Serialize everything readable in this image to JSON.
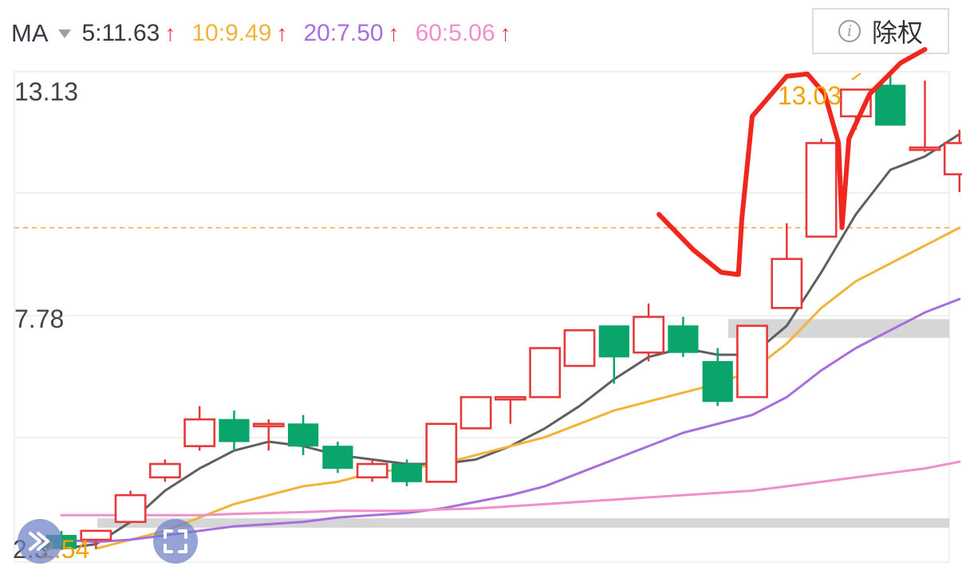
{
  "header": {
    "indicator_label": "MA",
    "ma_items": [
      {
        "text": "5:11.63",
        "color": "#333a44",
        "arrow": "↑"
      },
      {
        "text": "10:9.49",
        "color": "#f2b339",
        "arrow": "↑"
      },
      {
        "text": "20:7.50",
        "color": "#a86ee0",
        "arrow": "↑"
      },
      {
        "text": "60:5.06",
        "color": "#ef8fcb",
        "arrow": "↑"
      }
    ],
    "exright_icon": "i",
    "exright_label": "除权"
  },
  "chart_data": {
    "type": "candlestick",
    "price_high_label": "13.13",
    "price_mid_label": "7.78",
    "price_low_label": "2.54",
    "price_low_label_partial": "2.3",
    "max_marker_label": "13.03",
    "ylim": [
      2.3,
      13.3
    ],
    "reference_price": 9.8,
    "up_color": "#e63a3a",
    "down_color": "#0aa56b",
    "candles": [
      {
        "o": 2.9,
        "h": 3.0,
        "l": 2.6,
        "c": 2.6
      },
      {
        "o": 2.8,
        "h": 3.0,
        "l": 2.6,
        "c": 3.0
      },
      {
        "o": 3.2,
        "h": 3.9,
        "l": 3.2,
        "c": 3.8
      },
      {
        "o": 4.2,
        "h": 4.6,
        "l": 4.1,
        "c": 4.5
      },
      {
        "o": 4.9,
        "h": 5.8,
        "l": 4.8,
        "c": 5.5
      },
      {
        "o": 5.5,
        "h": 5.7,
        "l": 4.8,
        "c": 5.0
      },
      {
        "o": 5.4,
        "h": 5.5,
        "l": 4.8,
        "c": 5.4
      },
      {
        "o": 5.4,
        "h": 5.6,
        "l": 4.7,
        "c": 4.9
      },
      {
        "o": 4.9,
        "h": 5.0,
        "l": 4.3,
        "c": 4.4
      },
      {
        "o": 4.2,
        "h": 4.6,
        "l": 4.1,
        "c": 4.5
      },
      {
        "o": 4.5,
        "h": 4.6,
        "l": 4.0,
        "c": 4.1
      },
      {
        "o": 4.1,
        "h": 5.4,
        "l": 4.1,
        "c": 5.4
      },
      {
        "o": 5.3,
        "h": 6.0,
        "l": 5.3,
        "c": 6.0
      },
      {
        "o": 6.0,
        "h": 6.0,
        "l": 5.4,
        "c": 6.0
      },
      {
        "o": 6.0,
        "h": 7.1,
        "l": 6.0,
        "c": 7.1
      },
      {
        "o": 6.7,
        "h": 7.5,
        "l": 6.7,
        "c": 7.5
      },
      {
        "o": 7.6,
        "h": 7.6,
        "l": 6.3,
        "c": 6.9
      },
      {
        "o": 7.0,
        "h": 8.1,
        "l": 6.8,
        "c": 7.8
      },
      {
        "o": 7.6,
        "h": 7.8,
        "l": 6.9,
        "c": 7.0
      },
      {
        "o": 6.8,
        "h": 7.1,
        "l": 5.8,
        "c": 5.9
      },
      {
        "o": 6.0,
        "h": 7.6,
        "l": 6.0,
        "c": 7.6
      },
      {
        "o": 8.0,
        "h": 9.9,
        "l": 8.0,
        "c": 9.1
      },
      {
        "o": 9.6,
        "h": 11.8,
        "l": 9.6,
        "c": 11.7
      },
      {
        "o": 12.3,
        "h": 12.8,
        "l": 12.0,
        "c": 12.9
      },
      {
        "o": 13.0,
        "h": 13.3,
        "l": 12.1,
        "c": 12.1
      },
      {
        "o": 11.6,
        "h": 13.1,
        "l": 11.5,
        "c": 11.6
      },
      {
        "o": 11.0,
        "h": 12.0,
        "l": 10.6,
        "c": 11.7
      }
    ],
    "series": [
      {
        "period": 5,
        "color": "#5f5f5f",
        "x": [
          1,
          2,
          3,
          4,
          5,
          6,
          7,
          8,
          9,
          10,
          11,
          12,
          13,
          14,
          15,
          16,
          17,
          18,
          19,
          20,
          21,
          22,
          23,
          24,
          25,
          26,
          27
        ],
        "values": [
          2.6,
          2.7,
          3.2,
          3.9,
          4.4,
          4.8,
          5.0,
          4.9,
          4.7,
          4.6,
          4.5,
          4.5,
          4.6,
          4.9,
          5.3,
          5.8,
          6.4,
          6.9,
          7.1,
          6.95,
          6.95,
          7.6,
          8.8,
          10.1,
          11.1,
          11.4,
          11.9
        ]
      },
      {
        "period": 10,
        "color": "#f2b339",
        "x": [
          2,
          3,
          4,
          5,
          6,
          7,
          8,
          9,
          10,
          11,
          12,
          13,
          14,
          15,
          16,
          17,
          18,
          19,
          20,
          21,
          22,
          23,
          24,
          25,
          26,
          27
        ],
        "values": [
          2.6,
          2.8,
          3.0,
          3.3,
          3.6,
          3.8,
          4.0,
          4.1,
          4.3,
          4.4,
          4.5,
          4.7,
          4.9,
          5.1,
          5.4,
          5.7,
          5.9,
          6.1,
          6.3,
          6.6,
          7.2,
          8.0,
          8.6,
          9.0,
          9.4,
          9.8
        ]
      },
      {
        "period": 20,
        "color": "#a86ee0",
        "x": [
          1,
          2,
          3,
          4,
          5,
          6,
          7,
          8,
          9,
          10,
          11,
          12,
          13,
          14,
          15,
          16,
          17,
          18,
          19,
          20,
          21,
          22,
          23,
          24,
          25,
          26,
          27
        ],
        "values": [
          2.8,
          2.75,
          2.8,
          2.9,
          3.0,
          3.1,
          3.15,
          3.2,
          3.3,
          3.35,
          3.4,
          3.5,
          3.65,
          3.8,
          4.0,
          4.3,
          4.6,
          4.9,
          5.2,
          5.4,
          5.6,
          6.0,
          6.6,
          7.1,
          7.5,
          7.9,
          8.2
        ]
      },
      {
        "period": 60,
        "color": "#ef8fcb",
        "x": [
          1,
          2,
          3,
          4,
          5,
          6,
          7,
          8,
          9,
          10,
          11,
          12,
          13,
          14,
          15,
          16,
          17,
          18,
          19,
          20,
          21,
          22,
          23,
          24,
          25,
          26,
          27
        ],
        "values": [
          3.35,
          3.35,
          3.35,
          3.35,
          3.35,
          3.38,
          3.4,
          3.42,
          3.45,
          3.45,
          3.45,
          3.48,
          3.5,
          3.55,
          3.6,
          3.65,
          3.7,
          3.75,
          3.8,
          3.85,
          3.9,
          4.0,
          4.1,
          4.2,
          4.3,
          4.4,
          4.55
        ]
      }
    ],
    "bands": [
      {
        "low": 7.33,
        "high": 7.75,
        "from": 21
      },
      {
        "low": 3.07,
        "high": 3.28,
        "from": 1
      }
    ],
    "annotation_stroke": [
      [
        10.1,
        18.3
      ],
      [
        9.3,
        19.3
      ],
      [
        8.8,
        20.1
      ],
      [
        8.75,
        20.6
      ],
      [
        10.0,
        20.7
      ],
      [
        12.3,
        21.0
      ],
      [
        13.2,
        22.0
      ],
      [
        13.25,
        22.6
      ],
      [
        12.8,
        23.1
      ],
      [
        11.7,
        23.5
      ],
      [
        9.8,
        23.6
      ],
      [
        11.8,
        23.8
      ],
      [
        12.8,
        24.4
      ],
      [
        13.5,
        25.3
      ],
      [
        13.8,
        26.0
      ]
    ]
  }
}
